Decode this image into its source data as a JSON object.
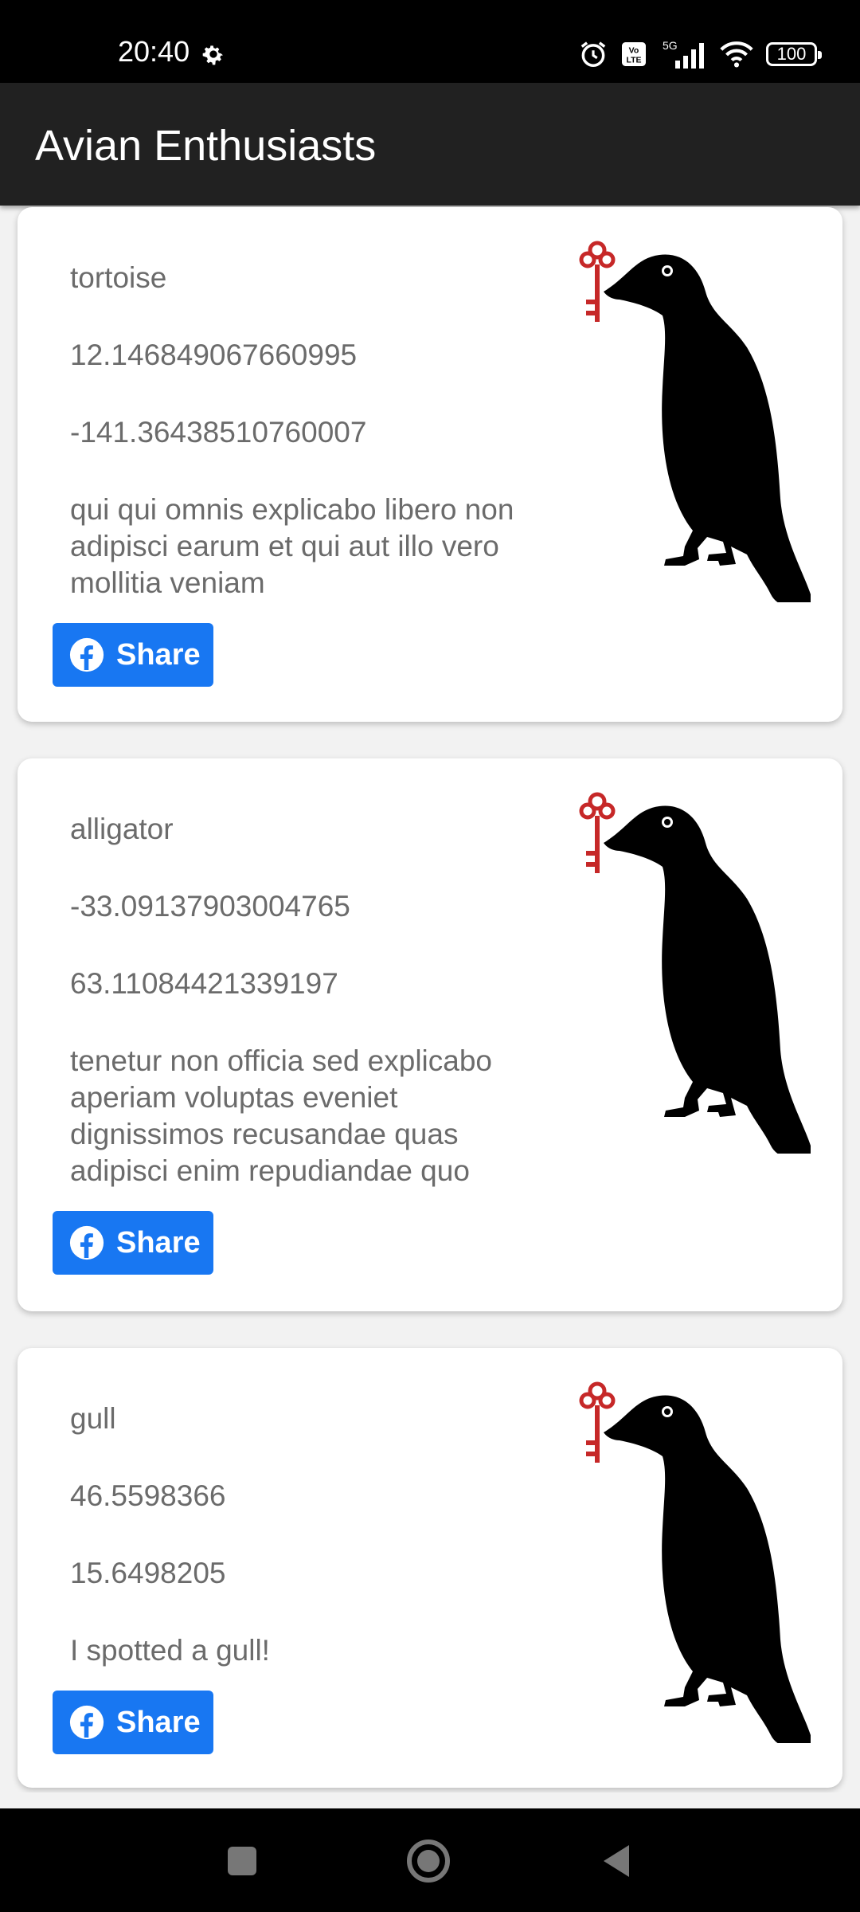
{
  "status_bar": {
    "time": "20:40",
    "battery": "100"
  },
  "app": {
    "title": "Avian Enthusiasts"
  },
  "cards": [
    {
      "species": "tortoise",
      "latitude": "12.146849067660995",
      "longitude": "-141.36438510760007",
      "description": "qui qui omnis explicabo libero non adipisci earum et qui aut illo vero mollitia veniam",
      "share_label": "Share"
    },
    {
      "species": "alligator",
      "latitude": "-33.09137903004765",
      "longitude": "63.11084421339197",
      "description": "tenetur non officia sed explicabo aperiam voluptas eveniet dignissimos recusandae quas adipisci enim repudiandae quo",
      "share_label": "Share"
    },
    {
      "species": "gull",
      "latitude": "46.5598366",
      "longitude": "15.6498205",
      "description": "I spotted a gull!",
      "share_label": "Share"
    }
  ],
  "colors": {
    "share_button": "#1877f2",
    "app_bar": "#212121",
    "key": "#c62828"
  },
  "icons": {
    "status": [
      "gear-icon",
      "alarm-icon",
      "volte-icon",
      "5g-signal-icon",
      "wifi-icon",
      "battery-icon"
    ],
    "card": [
      "facebook-icon",
      "crow-with-key-icon"
    ],
    "nav": [
      "recent-apps-icon",
      "home-icon",
      "back-icon"
    ]
  }
}
